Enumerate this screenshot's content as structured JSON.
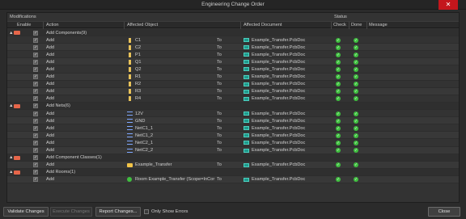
{
  "window": {
    "title": "Engineering Change Order",
    "close_glyph": "✕"
  },
  "groups": {
    "modifications": "Modifications",
    "status": "Status"
  },
  "columns": {
    "enable": "Enable",
    "action": "Action",
    "affected_object": "Affected Object",
    "affected_document": "Affected Document",
    "check": "Check",
    "done": "Done",
    "message": "Message"
  },
  "rows": [
    {
      "kind": "group",
      "label": "Add Components(9)"
    },
    {
      "kind": "item",
      "action": "Add",
      "object": "C1",
      "icon": "component-icon",
      "to": "To",
      "doc": "Example_Transfer.PcbDoc"
    },
    {
      "kind": "item",
      "action": "Add",
      "object": "C2",
      "icon": "component-icon",
      "to": "To",
      "doc": "Example_Transfer.PcbDoc"
    },
    {
      "kind": "item",
      "action": "Add",
      "object": "P1",
      "icon": "component-icon",
      "to": "To",
      "doc": "Example_Transfer.PcbDoc"
    },
    {
      "kind": "item",
      "action": "Add",
      "object": "Q1",
      "icon": "component-icon",
      "to": "To",
      "doc": "Example_Transfer.PcbDoc"
    },
    {
      "kind": "item",
      "action": "Add",
      "object": "Q2",
      "icon": "component-icon",
      "to": "To",
      "doc": "Example_Transfer.PcbDoc"
    },
    {
      "kind": "item",
      "action": "Add",
      "object": "R1",
      "icon": "component-icon",
      "to": "To",
      "doc": "Example_Transfer.PcbDoc"
    },
    {
      "kind": "item",
      "action": "Add",
      "object": "R2",
      "icon": "component-icon",
      "to": "To",
      "doc": "Example_Transfer.PcbDoc"
    },
    {
      "kind": "item",
      "action": "Add",
      "object": "R3",
      "icon": "component-icon",
      "to": "To",
      "doc": "Example_Transfer.PcbDoc"
    },
    {
      "kind": "item",
      "action": "Add",
      "object": "R4",
      "icon": "component-icon",
      "to": "To",
      "doc": "Example_Transfer.PcbDoc"
    },
    {
      "kind": "group",
      "label": "Add Nets(6)"
    },
    {
      "kind": "item",
      "action": "Add",
      "object": "12V",
      "icon": "net-icon",
      "to": "To",
      "doc": "Example_Transfer.PcbDoc"
    },
    {
      "kind": "item",
      "action": "Add",
      "object": "GND",
      "icon": "net-icon",
      "to": "To",
      "doc": "Example_Transfer.PcbDoc"
    },
    {
      "kind": "item",
      "action": "Add",
      "object": "NetC1_1",
      "icon": "net-icon",
      "to": "To",
      "doc": "Example_Transfer.PcbDoc"
    },
    {
      "kind": "item",
      "action": "Add",
      "object": "NetC1_2",
      "icon": "net-icon",
      "to": "To",
      "doc": "Example_Transfer.PcbDoc"
    },
    {
      "kind": "item",
      "action": "Add",
      "object": "NetC2_1",
      "icon": "net-icon",
      "to": "To",
      "doc": "Example_Transfer.PcbDoc"
    },
    {
      "kind": "item",
      "action": "Add",
      "object": "NetC2_2",
      "icon": "net-icon",
      "to": "To",
      "doc": "Example_Transfer.PcbDoc"
    },
    {
      "kind": "group",
      "label": "Add Component Classes(1)"
    },
    {
      "kind": "item",
      "action": "Add",
      "object": "Example_Transfer",
      "icon": "folder-icon",
      "to": "To",
      "doc": "Example_Transfer.PcbDoc"
    },
    {
      "kind": "group",
      "label": "Add Rooms(1)"
    },
    {
      "kind": "item",
      "action": "Add",
      "object": "Room Example_Transfer (Scope=InCor",
      "icon": "room-icon",
      "to": "To",
      "doc": "Example_Transfer.PcbDoc"
    }
  ],
  "footer": {
    "validate": "Validate Changes",
    "execute": "Execute Changes",
    "report": "Report Changes...",
    "only_errors": "Only Show Errors",
    "close": "Close"
  },
  "colors": {
    "ok_green": "#3fbf3f",
    "close_red": "#c4161c",
    "group_icon": "#e6664a"
  }
}
